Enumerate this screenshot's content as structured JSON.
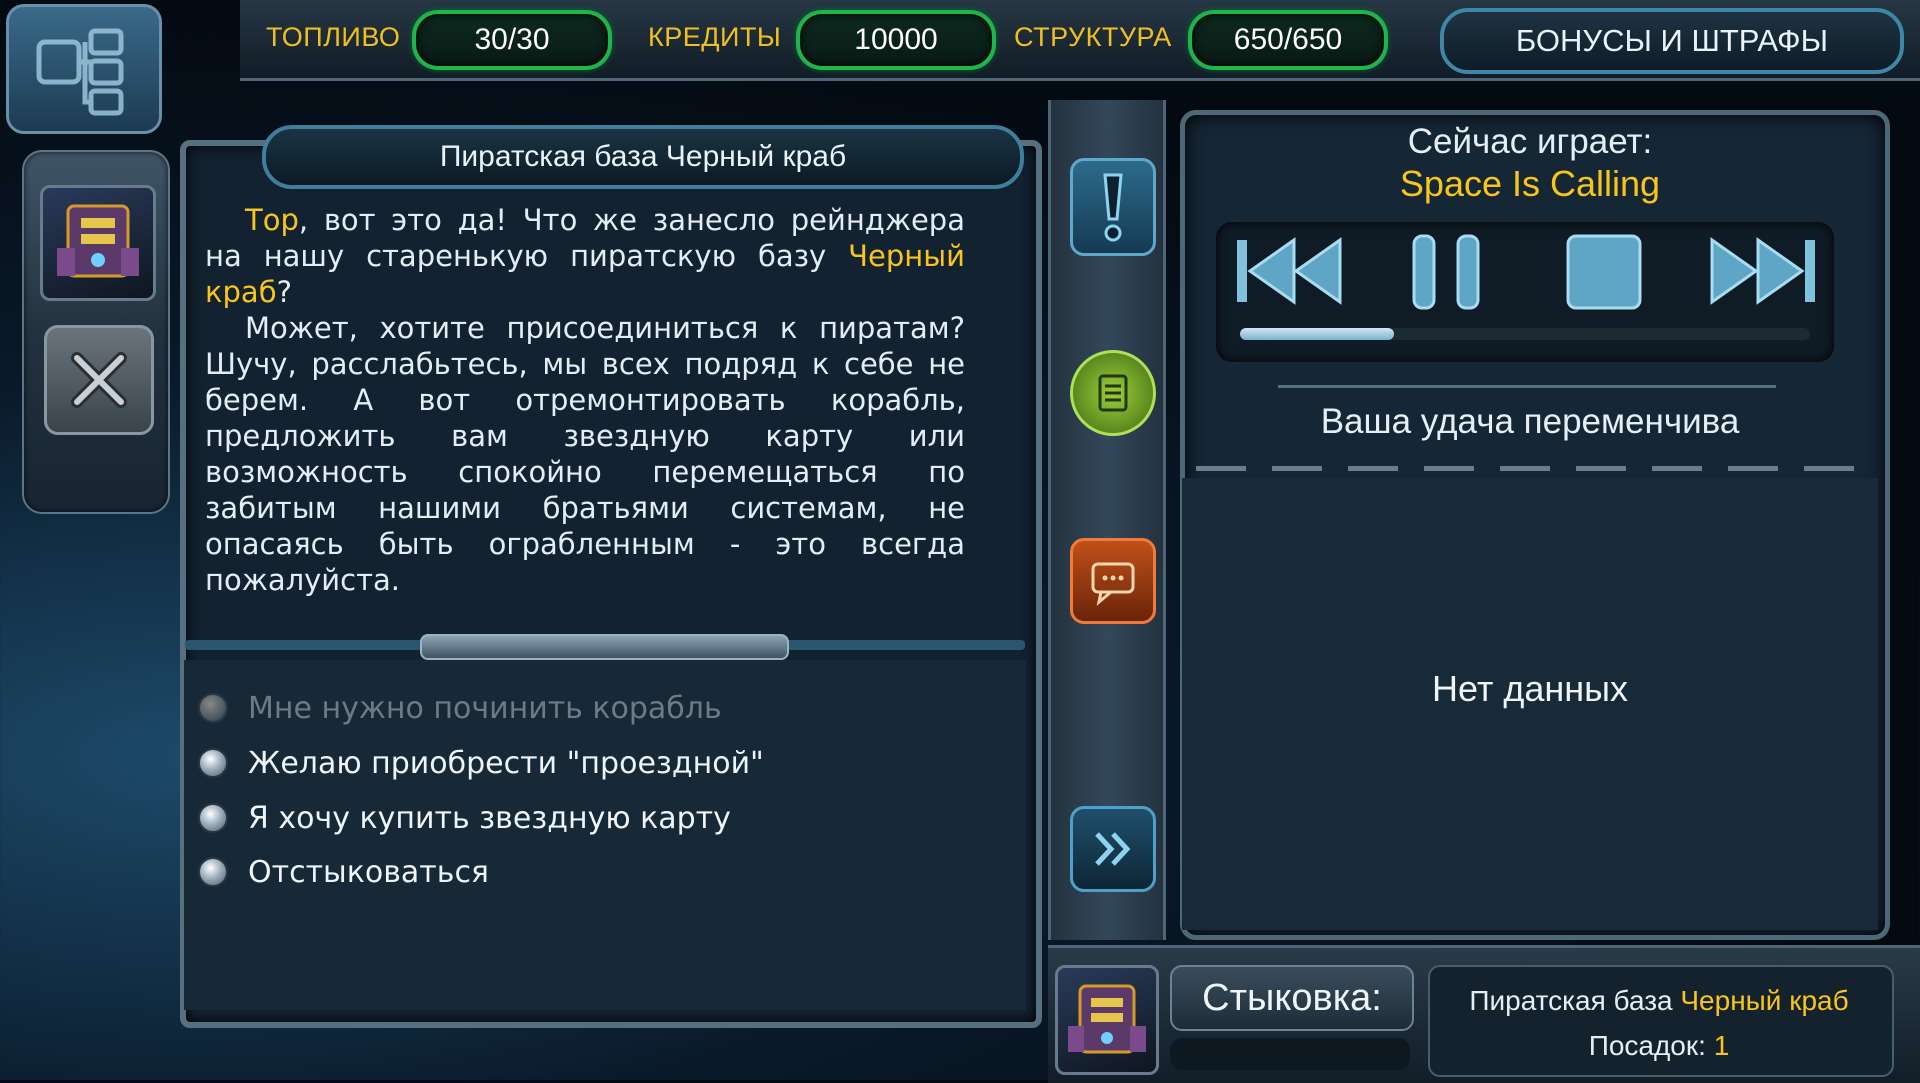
{
  "topbar": {
    "fuel_label": "ТОПЛИВО",
    "fuel_value": "30/30",
    "credits_label": "КРЕДИТЫ",
    "credits_value": "10000",
    "structure_label": "СТРУКТУРА",
    "structure_value": "650/650",
    "bonus_button": "БОНУСЫ И ШТРАФЫ"
  },
  "dialog": {
    "title": "Пиратская база Черный краб",
    "para1_name": "Тор",
    "para1_text_a": ", вот это да! Что же занесло рейнджера на нашу старенькую пиратскую базу ",
    "para1_base": "Черный краб",
    "para1_text_b": "?",
    "para2": "Может, хотите присоединиться к пиратам? Шучу, расслабьтесь, мы всех подряд к себе не берем. А вот отремонтировать корабль, предложить вам звездную карту или возможность спокойно перемещаться по забитым нашими братьями системам, не опасаясь быть ограбленным - это всегда пожалуйста.",
    "answers": [
      {
        "label": "Мне нужно починить корабль",
        "enabled": false
      },
      {
        "label": "Желаю приобрести \"проездной\"",
        "enabled": true
      },
      {
        "label": "Я хочу купить звездную карту",
        "enabled": true
      },
      {
        "label": "Отстыковаться",
        "enabled": true
      }
    ]
  },
  "player": {
    "now_playing_label": "Сейчас играет:",
    "song": "Space Is Calling",
    "progress": 0.27
  },
  "luck": {
    "title": "Ваша удача переменчива",
    "empty_text": "Нет данных"
  },
  "dock": {
    "label": "Стыковка:",
    "base_prefix": "Пиратская база ",
    "base_name": "Черный краб",
    "landings_label": "Посадок: ",
    "landings_value": "1"
  },
  "colors": {
    "highlight": "#f7c51c",
    "pill_border": "#1fb54c",
    "accent_blue": "#3f87a8"
  },
  "icons": {
    "menu": "network-icon",
    "close": "close-icon",
    "alert": "exclamation-icon",
    "log": "document-icon",
    "chat": "chat-icon",
    "next": "double-chevron-icon",
    "prev_track": "rewind-icon",
    "pause": "pause-icon",
    "stop": "stop-icon",
    "next_track": "fast-forward-icon"
  }
}
